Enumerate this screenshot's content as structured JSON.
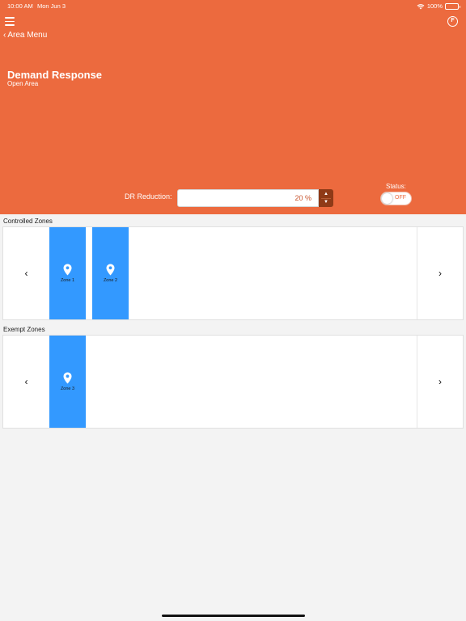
{
  "status_bar": {
    "time": "10:00 AM",
    "date": "Mon Jun 3",
    "battery": "100%"
  },
  "header": {
    "back_label": "Area Menu",
    "title": "Demand Response",
    "subtitle": "Open Area",
    "f_button": "F",
    "dr_label": "DR Reduction:",
    "dr_value": "20 %",
    "status_label": "Status:",
    "toggle_state": "OFF",
    "accent_color": "#ec6a3e"
  },
  "controlled": {
    "title": "Controlled Zones",
    "zones": [
      {
        "name": "Zone 1"
      },
      {
        "name": "Zone 2"
      }
    ]
  },
  "exempt": {
    "title": "Exempt Zones",
    "zones": [
      {
        "name": "Zone 3"
      }
    ]
  },
  "nav": {
    "prev": "‹",
    "next": "›"
  }
}
